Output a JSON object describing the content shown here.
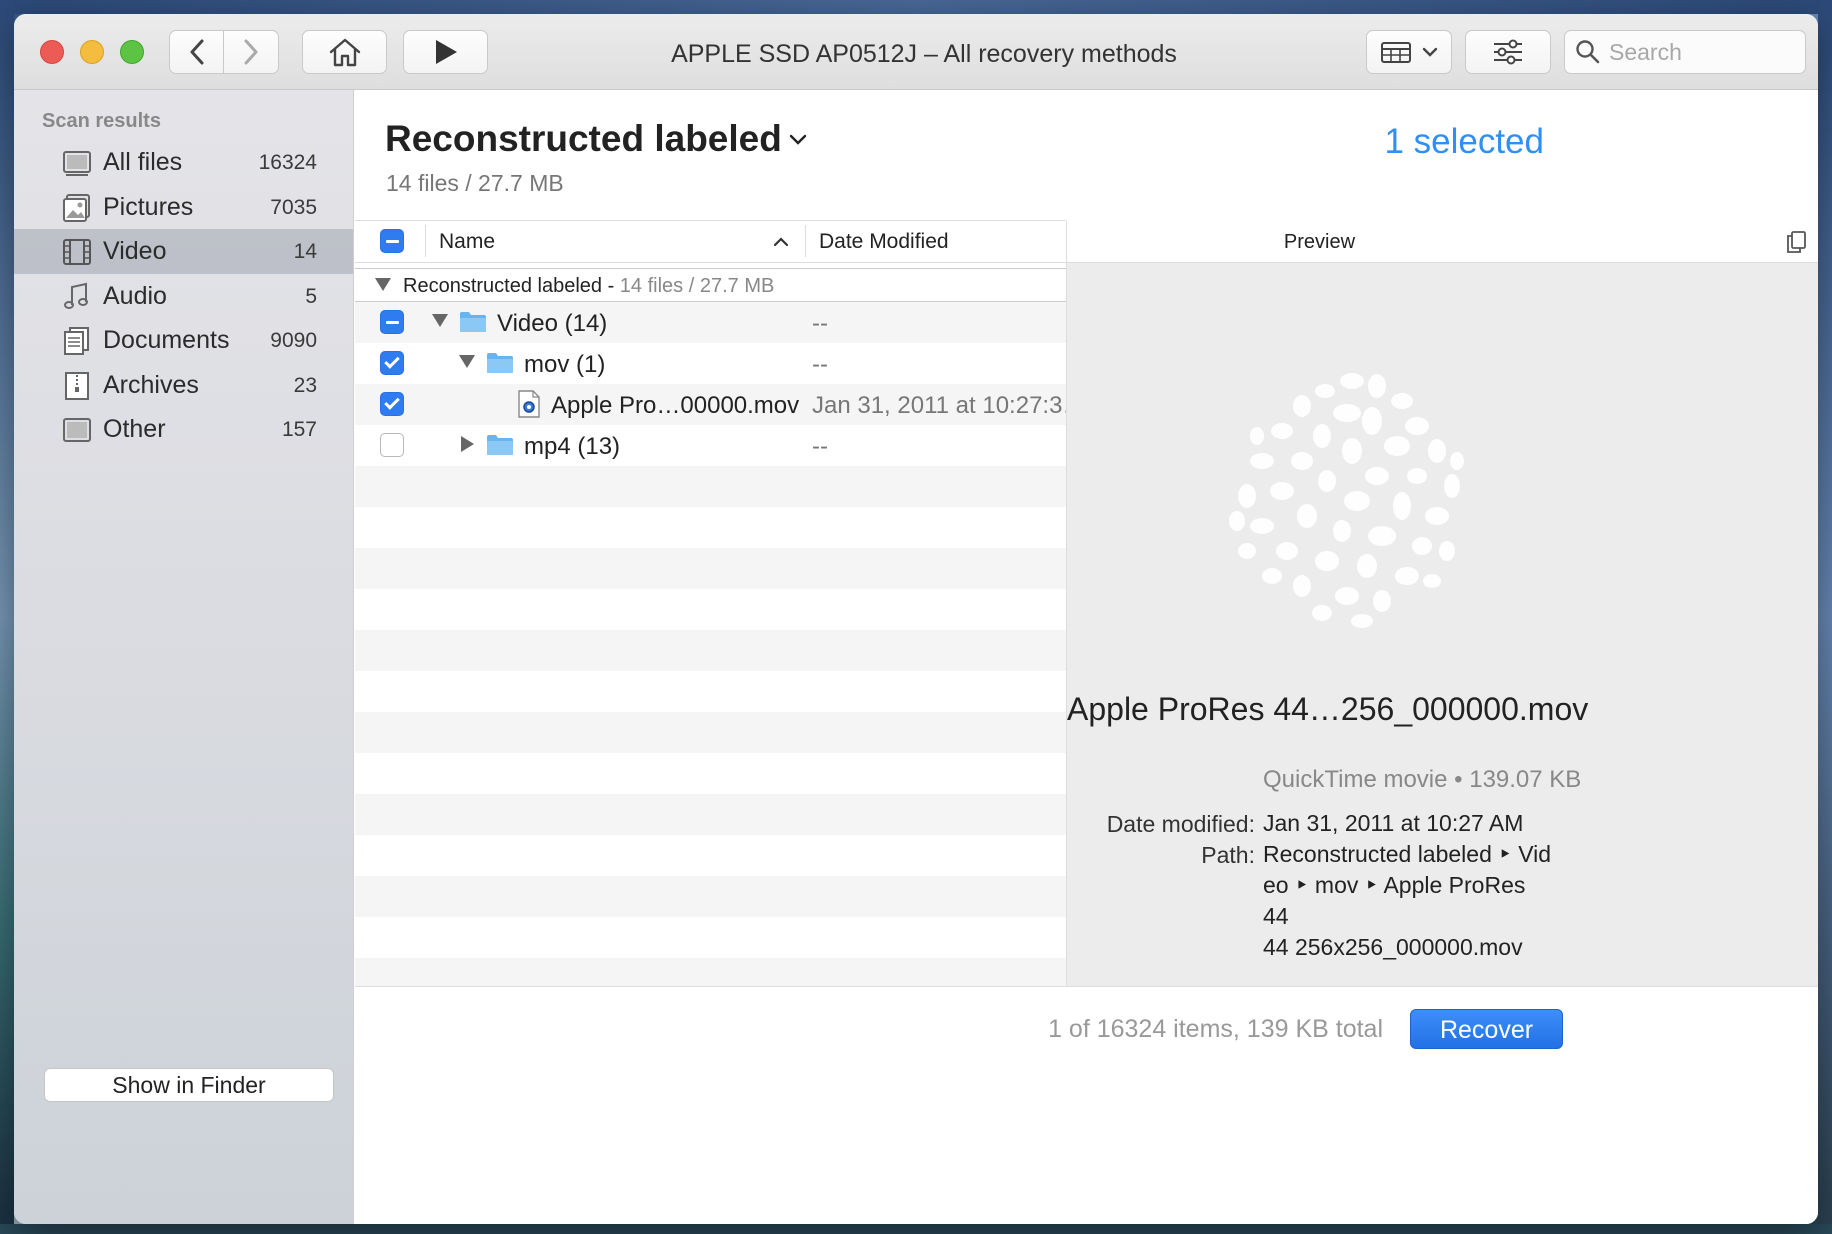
{
  "window": {
    "title": "APPLE SSD AP0512J – All recovery methods"
  },
  "toolbar": {
    "search_placeholder": "Search",
    "icons": [
      "chevron-left-icon",
      "chevron-right-icon",
      "home-icon",
      "play-icon",
      "view-grid-icon",
      "sliders-icon",
      "search-icon"
    ]
  },
  "sidebar": {
    "heading": "Scan results",
    "items": [
      {
        "label": "All files",
        "count": "16324",
        "icon": "all-files-icon"
      },
      {
        "label": "Pictures",
        "count": "7035",
        "icon": "pictures-icon"
      },
      {
        "label": "Video",
        "count": "14",
        "icon": "video-icon",
        "active": true
      },
      {
        "label": "Audio",
        "count": "5",
        "icon": "audio-icon"
      },
      {
        "label": "Documents",
        "count": "9090",
        "icon": "documents-icon"
      },
      {
        "label": "Archives",
        "count": "23",
        "icon": "archives-icon"
      },
      {
        "label": "Other",
        "count": "157",
        "icon": "other-icon"
      }
    ],
    "show_in_finder": "Show in Finder"
  },
  "main": {
    "title": "Reconstructed labeled",
    "subtitle": "14 files / 27.7 MB",
    "selected": "1 selected",
    "columns": {
      "name": "Name",
      "date": "Date Modified"
    },
    "group": {
      "label": "Reconstructed labeled",
      "sep": " - ",
      "meta": "14 files / 27.7 MB"
    },
    "rows": [
      {
        "name": "Video (14)",
        "date": "--",
        "check": "mixed",
        "disclosure": "open",
        "type": "folder"
      },
      {
        "name": "mov (1)",
        "date": "--",
        "check": "checked",
        "disclosure": "open",
        "type": "folder"
      },
      {
        "name": "Apple Pro…00000.mov",
        "date": "Jan 31, 2011 at 10:27:3…",
        "check": "checked",
        "disclosure": "none",
        "type": "file"
      },
      {
        "name": "mp4 (13)",
        "date": "--",
        "check": "unchecked",
        "disclosure": "closed",
        "type": "folder"
      }
    ]
  },
  "preview": {
    "title": "Preview",
    "file_name": "Apple ProRes 44…256_000000.mov",
    "file_kind": "QuickTime movie • 139.07 KB",
    "date_label": "Date modified:",
    "date_value": "Jan 31, 2011 at 10:27 AM",
    "path_label": "Path:",
    "path_lines": [
      "Reconstructed labeled ‣ Vid",
      "eo ‣ mov ‣ Apple ProRes 44",
      "44 256x256_000000.mov"
    ]
  },
  "footer": {
    "status": "1 of 16324 items, 139 KB total",
    "recover": "Recover"
  },
  "colors": {
    "accent": "#2f8ff5",
    "close": "#ed5b56",
    "minimize": "#f5bd3f",
    "maximize": "#5dc344"
  }
}
